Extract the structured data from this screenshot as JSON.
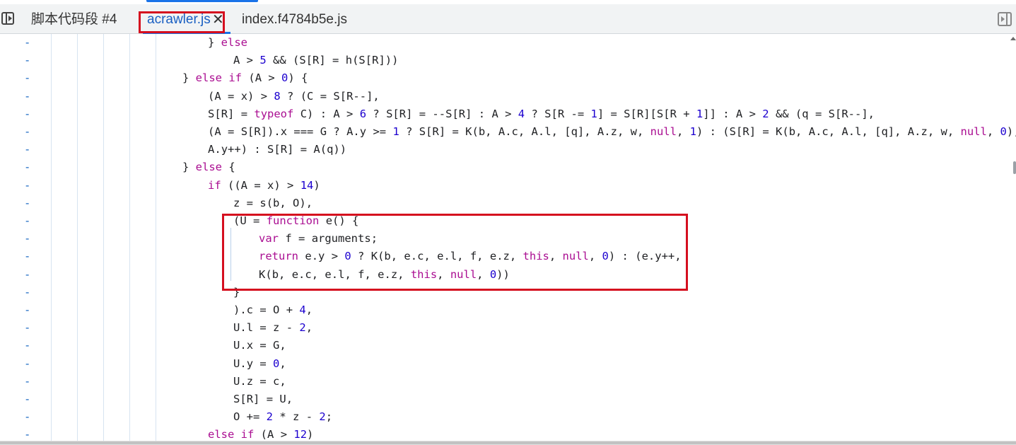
{
  "tabs": {
    "snippet_label": "脚本代码段 #4",
    "active_label": "acrawler.js",
    "close_glyph": "✕",
    "index_label": "index.f4784b5e.js"
  },
  "icons": {
    "navigator_toggle": "sidebar-left-toggle-icon",
    "debugger_toggle": "sidebar-right-toggle-icon"
  },
  "colors": {
    "keyword": "#aa0d91",
    "number": "#1c00cf",
    "highlight_box": "#d50f1f",
    "active_tab": "#1a5fc2"
  },
  "gutter_marker": "-",
  "code_lines": [
    "} else",
    "A > 5 && (S[R] = h(S[R]))",
    "} else if (A > 0) {",
    "(A = x) > 8 ? (C = S[R--],",
    "S[R] = typeof C) : A > 6 ? S[R] = --S[R] : A > 4 ? S[R -= 1] = S[R][S[R + 1]] : A > 2 && (q = S[R--],",
    "(A = S[R]).x === G ? A.y >= 1 ? S[R] = K(b, A.c, A.l, [q], A.z, w, null, 1) : (S[R] = K(b, A.c, A.l, [q], A.z, w, null, 0),",
    "A.y++) : S[R] = A(q))",
    "} else {",
    "if ((A = x) > 14)",
    "z = s(b, O),",
    "(U = function e() {",
    "var f = arguments;",
    "return e.y > 0 ? K(b, e.c, e.l, f, e.z, this, null, 0) : (e.y++,",
    "K(b, e.c, e.l, f, e.z, this, null, 0))",
    "}",
    ").c = O + 4,",
    "U.l = z - 2,",
    "U.x = G,",
    "U.y = 0,",
    "U.z = c,",
    "S[R] = U,",
    "O += 2 * z - 2;",
    "else if (A > 12)"
  ]
}
